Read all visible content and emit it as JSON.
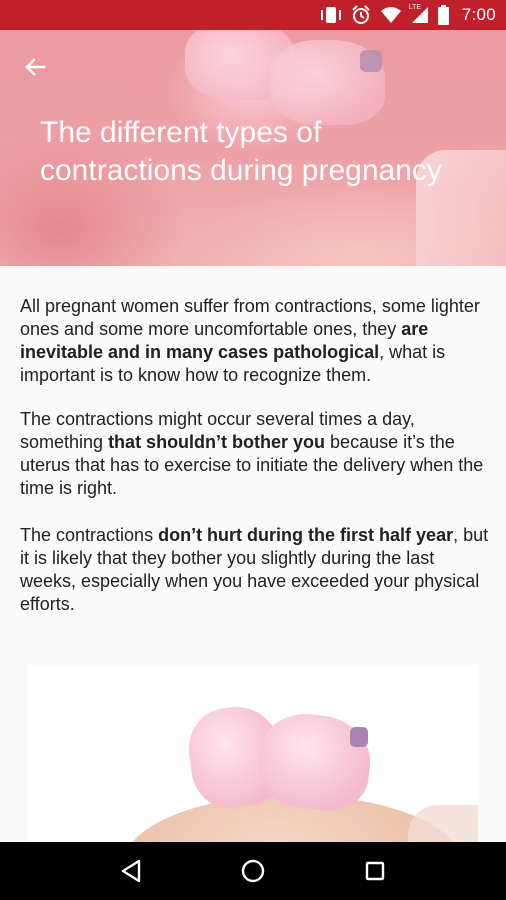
{
  "status_bar": {
    "time": "7:00",
    "icons": [
      "vibrate-icon",
      "alarm-icon",
      "wifi-icon",
      "lte-signal-icon",
      "battery-icon"
    ],
    "lte_label": "LTE",
    "background_color": "#c0202a"
  },
  "header": {
    "back_icon": "arrow-left-icon",
    "title": "The different types of contractions during pregnancy"
  },
  "article": {
    "paragraphs": [
      {
        "before": "All pregnant women suffer from contractions, some lighter ones and some more uncomfortable ones, they ",
        "bold": "are inevitable and in many cases pathological",
        "after": ", what is important is to know how to recognize them."
      },
      {
        "before": "The contractions might occur several times a day, something ",
        "bold": "that shouldn’t bother you",
        "after": " because it’s the uterus that has to exercise to initiate the delivery when the time is right."
      },
      {
        "before": "The contractions ",
        "bold": "don’t hurt during the first half year",
        "after": ", but it is likely that they bother you slightly during the last weeks, especially when you have exceeded your physical efforts."
      }
    ]
  },
  "navigation_bar": {
    "buttons": [
      "back-triangle-icon",
      "home-circle-icon",
      "recents-square-icon"
    ]
  }
}
